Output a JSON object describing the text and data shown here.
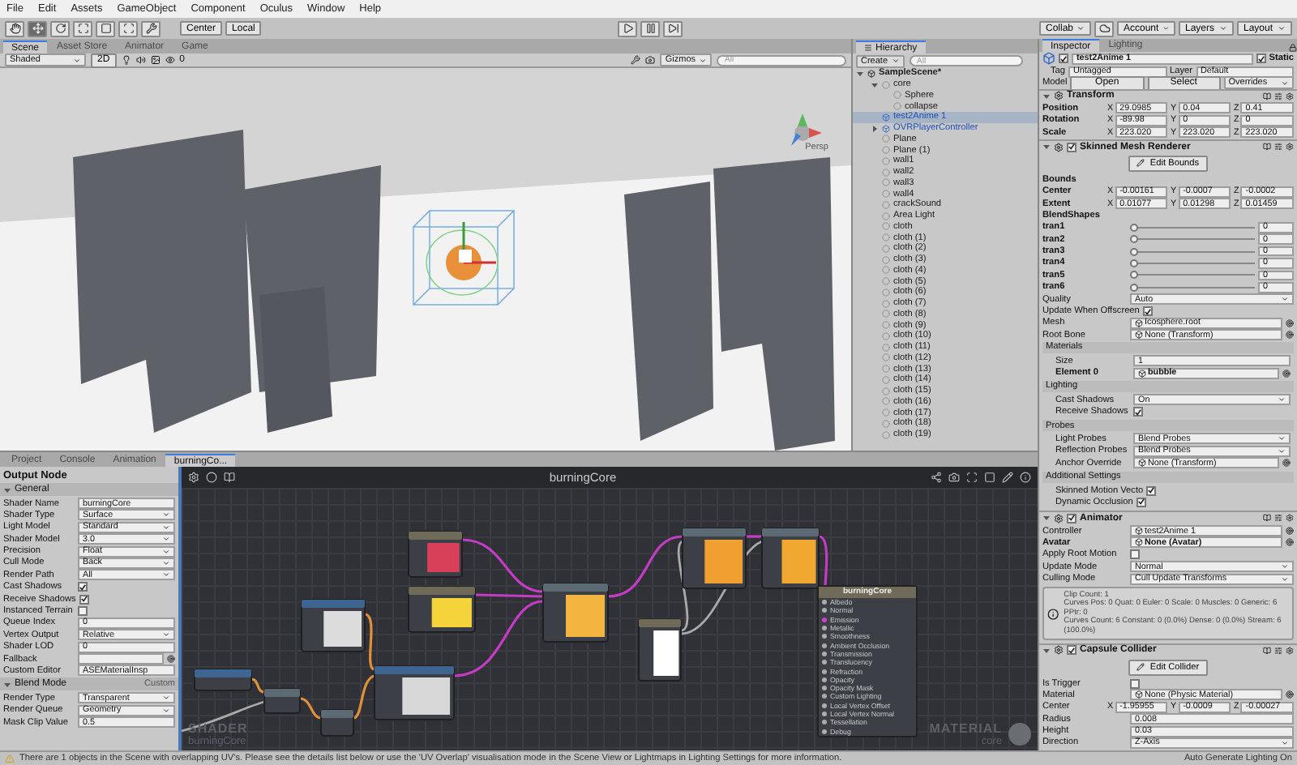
{
  "menu": [
    "File",
    "Edit",
    "Assets",
    "GameObject",
    "Component",
    "Oculus",
    "Window",
    "Help"
  ],
  "toolbar": {
    "tools": [
      {
        "selected": false
      },
      {
        "selected": true
      },
      {
        "selected": false
      },
      {
        "selected": false
      },
      {
        "selected": false
      },
      {
        "selected": false
      },
      {
        "selected": false
      }
    ],
    "pivot": "Center",
    "space": "Local",
    "collab": "Collab",
    "account": "Account",
    "layers": "Layers",
    "layout": "Layout"
  },
  "scene": {
    "tabs": [
      {
        "label": "Scene",
        "selected": true
      },
      {
        "label": "Asset Store",
        "selected": false
      },
      {
        "label": "Animator",
        "selected": false
      },
      {
        "label": "Game",
        "selected": false
      }
    ],
    "shading": "Shaded",
    "mode_2d": "2D",
    "hidden_count": "0",
    "gizmos": "Gizmos",
    "search_placeholder": "All",
    "projection": "Persp"
  },
  "hierarchy": {
    "title": "Hierarchy",
    "create": "Create",
    "search_placeholder": "All",
    "scene": {
      "label": "SampleScene*",
      "expanded": true,
      "children": [
        {
          "label": "core",
          "kind": "object",
          "selected": false,
          "expanded": true,
          "children": [
            {
              "label": "Sphere",
              "kind": "object",
              "selected": false
            },
            {
              "label": "collapse",
              "kind": "object",
              "selected": false
            }
          ]
        },
        {
          "label": "test2Anime 1",
          "kind": "prefab",
          "selected": true
        },
        {
          "label": "OVRPlayerController",
          "kind": "prefab",
          "selected": false,
          "expanded": false
        },
        {
          "label": "Plane",
          "kind": "object",
          "selected": false
        },
        {
          "label": "Plane (1)",
          "kind": "object",
          "selected": false
        },
        {
          "label": "wall1",
          "kind": "object",
          "selected": false
        },
        {
          "label": "wall2",
          "kind": "object",
          "selected": false
        },
        {
          "label": "wall3",
          "kind": "object",
          "selected": false
        },
        {
          "label": "wall4",
          "kind": "object",
          "selected": false
        },
        {
          "label": "crackSound",
          "kind": "object",
          "selected": false
        },
        {
          "label": "Area Light",
          "kind": "object",
          "selected": false
        },
        {
          "label": "cloth",
          "kind": "object",
          "selected": false
        },
        {
          "label": "cloth (1)",
          "kind": "object",
          "selected": false
        },
        {
          "label": "cloth (2)",
          "kind": "object",
          "selected": false
        },
        {
          "label": "cloth (3)",
          "kind": "object",
          "selected": false
        },
        {
          "label": "cloth (4)",
          "kind": "object",
          "selected": false
        },
        {
          "label": "cloth (5)",
          "kind": "object",
          "selected": false
        },
        {
          "label": "cloth (6)",
          "kind": "object",
          "selected": false
        },
        {
          "label": "cloth (7)",
          "kind": "object",
          "selected": false
        },
        {
          "label": "cloth (8)",
          "kind": "object",
          "selected": false
        },
        {
          "label": "cloth (9)",
          "kind": "object",
          "selected": false
        },
        {
          "label": "cloth (10)",
          "kind": "object",
          "selected": false
        },
        {
          "label": "cloth (11)",
          "kind": "object",
          "selected": false
        },
        {
          "label": "cloth (12)",
          "kind": "object",
          "selected": false
        },
        {
          "label": "cloth (13)",
          "kind": "object",
          "selected": false
        },
        {
          "label": "cloth (14)",
          "kind": "object",
          "selected": false
        },
        {
          "label": "cloth (15)",
          "kind": "object",
          "selected": false
        },
        {
          "label": "cloth (16)",
          "kind": "object",
          "selected": false
        },
        {
          "label": "cloth (17)",
          "kind": "object",
          "selected": false
        },
        {
          "label": "cloth (18)",
          "kind": "object",
          "selected": false
        },
        {
          "label": "cloth (19)",
          "kind": "object",
          "selected": false
        }
      ]
    }
  },
  "bottom_tabs": [
    {
      "label": "Project",
      "selected": false
    },
    {
      "label": "Console",
      "selected": false
    },
    {
      "label": "Animation",
      "selected": false
    },
    {
      "label": "burningCo...",
      "selected": true
    }
  ],
  "output_node": {
    "title": "Output Node",
    "sections": [
      {
        "title": "General",
        "expanded": true,
        "rows": [
          {
            "kind": "field",
            "label": "Shader Name",
            "value": "burningCore"
          },
          {
            "kind": "dropdown",
            "label": "Shader Type",
            "value": "Surface"
          },
          {
            "kind": "dropdown",
            "label": "Light Model",
            "value": "Standard"
          },
          {
            "kind": "dropdown",
            "label": "Shader Model",
            "value": "3.0"
          },
          {
            "kind": "dropdown",
            "label": "Precision",
            "value": "Float"
          },
          {
            "kind": "dropdown",
            "label": "Cull Mode",
            "value": "Back"
          },
          {
            "kind": "dropdown",
            "label": "Render Path",
            "value": "All"
          },
          {
            "kind": "checkbox",
            "label": "Cast Shadows",
            "checked": true
          },
          {
            "kind": "checkbox",
            "label": "Receive Shadows",
            "checked": true
          },
          {
            "kind": "checkbox",
            "label": "Instanced Terrain",
            "checked": false
          },
          {
            "kind": "field",
            "label": "Queue Index",
            "value": "0"
          },
          {
            "kind": "dropdown",
            "label": "Vertex Output",
            "value": "Relative"
          },
          {
            "kind": "field",
            "label": "Shader LOD",
            "value": "0"
          },
          {
            "kind": "object",
            "label": "Fallback"
          },
          {
            "kind": "field",
            "label": "Custom Editor",
            "value": "ASEMaterialInsp"
          }
        ]
      },
      {
        "title": "Blend Mode",
        "expanded": true,
        "value": "Custom",
        "rows": [
          {
            "kind": "dropdown",
            "label": "Render Type",
            "value": "Transparent"
          },
          {
            "kind": "dropdown",
            "label": "Render Queue",
            "value": "Geometry"
          },
          {
            "kind": "field",
            "label": "Mask Clip Value",
            "value": "0.5"
          }
        ]
      }
    ]
  },
  "graph": {
    "title": "burningCore",
    "watermark_left": [
      "SHADER",
      "burningCore"
    ],
    "watermark_right": [
      "MATERIAL",
      "core"
    ],
    "output": {
      "title": "burningCore",
      "ports": [
        "Albedo",
        "Normal",
        "Emission",
        "Metallic",
        "Smoothness",
        "Ambient Occlusion",
        "Transmission",
        "Translucency",
        "Refraction",
        "Opacity",
        "Opacity Mask",
        "Custom Lighting",
        "Local Vertex Offset",
        "Local Vertex Normal",
        "Tessellation",
        "Debug"
      ]
    }
  },
  "inspector": {
    "tabs": [
      {
        "label": "Inspector",
        "selected": true
      },
      {
        "label": "Lighting",
        "selected": false
      }
    ],
    "object": {
      "name": "test2Anime 1",
      "active": true,
      "static": true,
      "static_label": "Static",
      "tag_label": "Tag",
      "tag": "Untagged",
      "layer_label": "Layer",
      "layer": "Default",
      "model_label": "Model",
      "open": "Open",
      "select": "Select",
      "overrides": "Overrides"
    },
    "components": [
      {
        "title": "Transform",
        "expanded": true,
        "rows": [
          {
            "kind": "vector",
            "label": "Position",
            "bold": true,
            "values": [
              {
                "axis": "X",
                "value": "29.0985"
              },
              {
                "axis": "Y",
                "value": "0.04"
              },
              {
                "axis": "Z",
                "value": "0.41"
              }
            ]
          },
          {
            "kind": "vector",
            "label": "Rotation",
            "bold": true,
            "values": [
              {
                "axis": "X",
                "value": "-89.98"
              },
              {
                "axis": "Y",
                "value": "0"
              },
              {
                "axis": "Z",
                "value": "0"
              }
            ]
          },
          {
            "kind": "vector",
            "label": "Scale",
            "bold": true,
            "values": [
              {
                "axis": "X",
                "value": "223.020"
              },
              {
                "axis": "Y",
                "value": "223.020"
              },
              {
                "axis": "Z",
                "value": "223.020"
              }
            ]
          }
        ]
      },
      {
        "title": "Skinned Mesh Renderer",
        "expanded": true,
        "enabled": true,
        "rows": [
          {
            "kind": "button",
            "label": "Edit Bounds"
          },
          {
            "kind": "label",
            "label": "Bounds",
            "bold": true
          },
          {
            "kind": "vector",
            "label": "Center",
            "bold": true,
            "values": [
              {
                "axis": "X",
                "value": "-0.00161"
              },
              {
                "axis": "Y",
                "value": "-0.0007"
              },
              {
                "axis": "Z",
                "value": "-0.0002"
              }
            ]
          },
          {
            "kind": "vector",
            "label": "Extent",
            "bold": true,
            "values": [
              {
                "axis": "X",
                "value": "0.01077"
              },
              {
                "axis": "Y",
                "value": "0.01298"
              },
              {
                "axis": "Z",
                "value": "0.01459"
              }
            ]
          },
          {
            "kind": "label",
            "label": "BlendShapes",
            "bold": true
          },
          {
            "kind": "slider",
            "label": "tran1",
            "bold": true,
            "level": 0,
            "value": "0"
          },
          {
            "kind": "slider",
            "label": "tran2",
            "bold": true,
            "level": 0,
            "value": "0"
          },
          {
            "kind": "slider",
            "label": "tran3",
            "bold": true,
            "level": 0,
            "value": "0"
          },
          {
            "kind": "slider",
            "label": "tran4",
            "bold": true,
            "level": 0,
            "value": "0"
          },
          {
            "kind": "slider",
            "label": "tran5",
            "bold": true,
            "level": 0,
            "value": "0"
          },
          {
            "kind": "slider",
            "label": "tran6",
            "bold": true,
            "level": 0,
            "value": "0"
          },
          {
            "kind": "dropdown",
            "label": "Quality",
            "value": "Auto"
          },
          {
            "kind": "checkbox",
            "label": "Update When Offscreen",
            "checked": true
          },
          {
            "kind": "object",
            "label": "Mesh",
            "value": "Icosphere.root"
          },
          {
            "kind": "object",
            "label": "Root Bone",
            "value": "None (Transform)"
          },
          {
            "kind": "group",
            "label": "Materials",
            "children": [
              {
                "kind": "field",
                "label": "Size",
                "value": "1"
              },
              {
                "kind": "object",
                "label": "Element 0",
                "value": "bubble",
                "bold": true
              }
            ]
          },
          {
            "kind": "group",
            "label": "Lighting",
            "children": [
              {
                "kind": "dropdown",
                "label": "Cast Shadows",
                "value": "On"
              },
              {
                "kind": "checkbox",
                "label": "Receive Shadows",
                "checked": true
              }
            ]
          },
          {
            "kind": "group",
            "label": "Probes",
            "children": [
              {
                "kind": "dropdown",
                "label": "Light Probes",
                "value": "Blend Probes"
              },
              {
                "kind": "dropdown",
                "label": "Reflection Probes",
                "value": "Blend Probes"
              },
              {
                "kind": "object",
                "label": "Anchor Override",
                "value": "None (Transform)"
              }
            ]
          },
          {
            "kind": "group",
            "label": "Additional Settings",
            "children": [
              {
                "kind": "checkbox",
                "label": "Skinned Motion Vecto",
                "checked": true
              },
              {
                "kind": "checkbox",
                "label": "Dynamic Occlusion",
                "checked": true
              }
            ]
          }
        ]
      },
      {
        "title": "Animator",
        "expanded": true,
        "enabled": true,
        "rows": [
          {
            "kind": "object",
            "label": "Controller",
            "value": "test2Anime 1"
          },
          {
            "kind": "object",
            "label": "Avatar",
            "value": "None (Avatar)",
            "bold": true
          },
          {
            "kind": "checkbox",
            "label": "Apply Root Motion",
            "checked": false
          },
          {
            "kind": "dropdown",
            "label": "Update Mode",
            "value": "Normal"
          },
          {
            "kind": "dropdown",
            "label": "Culling Mode",
            "value": "Cull Update Transforms"
          },
          {
            "kind": "info",
            "lines": [
              "Clip Count: 1",
              "Curves Pos: 0 Quat: 0 Euler: 0 Scale: 0 Muscles: 0 Generic: 6 PPtr: 0",
              "Curves Count: 6 Constant: 0 (0.0%) Dense: 0 (0.0%) Stream: 6 (100.0%)"
            ]
          }
        ]
      },
      {
        "title": "Capsule Collider",
        "expanded": true,
        "enabled": true,
        "rows": [
          {
            "kind": "button",
            "label": "Edit Collider"
          },
          {
            "kind": "checkbox",
            "label": "Is Trigger",
            "checked": false
          },
          {
            "kind": "object",
            "label": "Material",
            "value": "None (Physic Material)"
          },
          {
            "kind": "vector",
            "label": "Center",
            "values": [
              {
                "axis": "X",
                "value": "-1.95955"
              },
              {
                "axis": "Y",
                "value": "-0.0009"
              },
              {
                "axis": "Z",
                "value": "-0.00027"
              }
            ]
          },
          {
            "kind": "field",
            "label": "Radius",
            "value": "0.008"
          },
          {
            "kind": "field",
            "label": "Height",
            "value": "0.03"
          },
          {
            "kind": "dropdown",
            "label": "Direction",
            "value": "Z-Axis"
          }
        ]
      }
    ]
  },
  "status": {
    "message": "There are 1 objects in the Scene with overlapping UV's. Please see the details list below or use the 'UV Overlap' visualisation mode in the Scene View or Lightmaps in Lighting Settings for more information.",
    "lighting": "Auto Generate Lighting On"
  }
}
